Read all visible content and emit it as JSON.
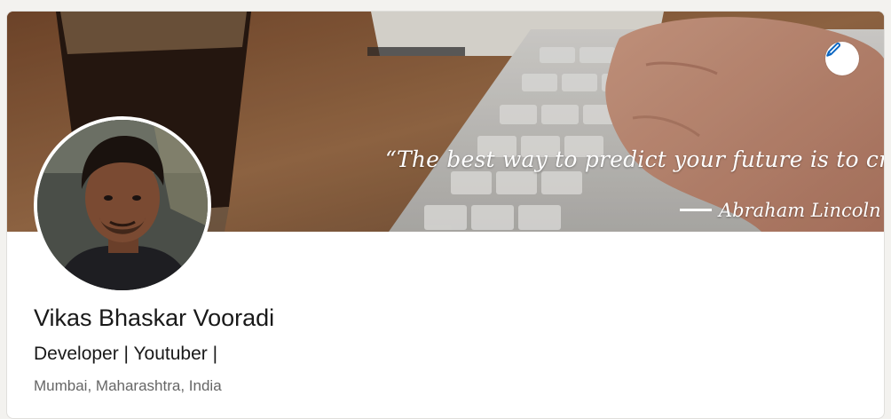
{
  "banner": {
    "quote": "“The best way to predict your future is to create it.”",
    "author": "Abraham Lincoln",
    "edit_icon": "pencil-icon"
  },
  "profile": {
    "name": "Vikas Bhaskar Vooradi",
    "headline": "Developer | Youtuber |",
    "location": "Mumbai, Maharashtra, India"
  },
  "colors": {
    "accent": "#0a66c2",
    "text_primary": "#191919",
    "text_secondary": "#666666"
  }
}
